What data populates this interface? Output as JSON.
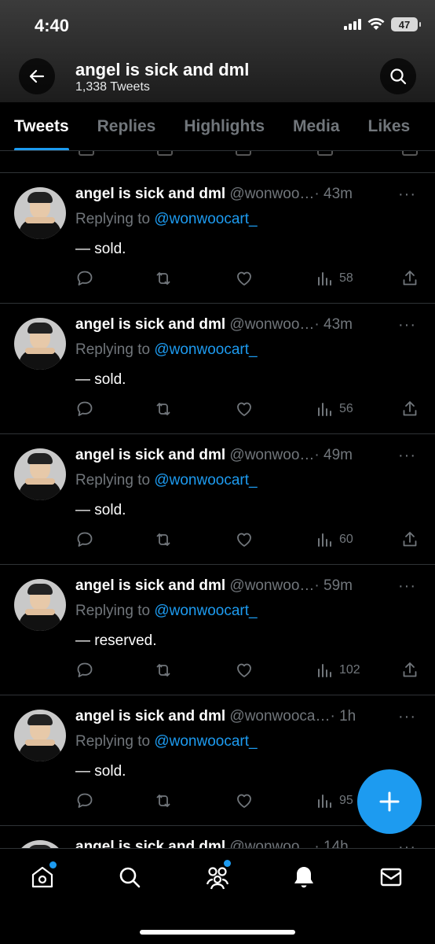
{
  "status_bar": {
    "time": "4:40",
    "battery": "47"
  },
  "header": {
    "title": "angel is sick and dml",
    "tweet_count": "1,338 Tweets"
  },
  "tabs": [
    {
      "label": "Tweets",
      "active": true
    },
    {
      "label": "Replies",
      "active": false
    },
    {
      "label": "Highlights",
      "active": false
    },
    {
      "label": "Media",
      "active": false
    },
    {
      "label": "Likes",
      "active": false
    }
  ],
  "tweets": [
    {
      "name": "angel is sick and dml",
      "handle": "@wonwoo…",
      "time": "· 43m",
      "replying_label": "Replying to",
      "mention": "@wonwoocart_",
      "text": "— sold.",
      "views": "58"
    },
    {
      "name": "angel is sick and dml",
      "handle": "@wonwoo…",
      "time": "· 43m",
      "replying_label": "Replying to",
      "mention": "@wonwoocart_",
      "text": "— sold.",
      "views": "56"
    },
    {
      "name": "angel is sick and dml",
      "handle": "@wonwoo…",
      "time": "· 49m",
      "replying_label": "Replying to",
      "mention": "@wonwoocart_",
      "text": "— sold.",
      "views": "60"
    },
    {
      "name": "angel is sick and dml",
      "handle": "@wonwoo…",
      "time": "· 59m",
      "replying_label": "Replying to",
      "mention": "@wonwoocart_",
      "text": "— reserved.",
      "views": "102"
    },
    {
      "name": "angel is sick and dml",
      "handle": "@wonwooca…",
      "time": "· 1h",
      "replying_label": "Replying to",
      "mention": "@wonwoocart_",
      "text": "— sold.",
      "views": "95"
    },
    {
      "name": "angel is sick and dml",
      "handle": "@wonwoo…",
      "time": "· 14h",
      "replying_label": "",
      "mention": "",
      "text": "",
      "views": ""
    }
  ],
  "more_glyph": "···",
  "colors": {
    "accent": "#1d9bf0",
    "background": "#000000",
    "muted": "#71767b",
    "divider": "#2f3336"
  },
  "icons": {
    "back": "arrow-left-icon",
    "search": "search-icon",
    "reply": "reply-icon",
    "retweet": "retweet-icon",
    "like": "heart-icon",
    "views": "views-icon",
    "share": "share-icon",
    "compose": "plus-icon",
    "home": "home-icon",
    "explore": "search-icon",
    "communities": "communities-icon",
    "notifications": "bell-icon",
    "messages": "mail-icon"
  }
}
